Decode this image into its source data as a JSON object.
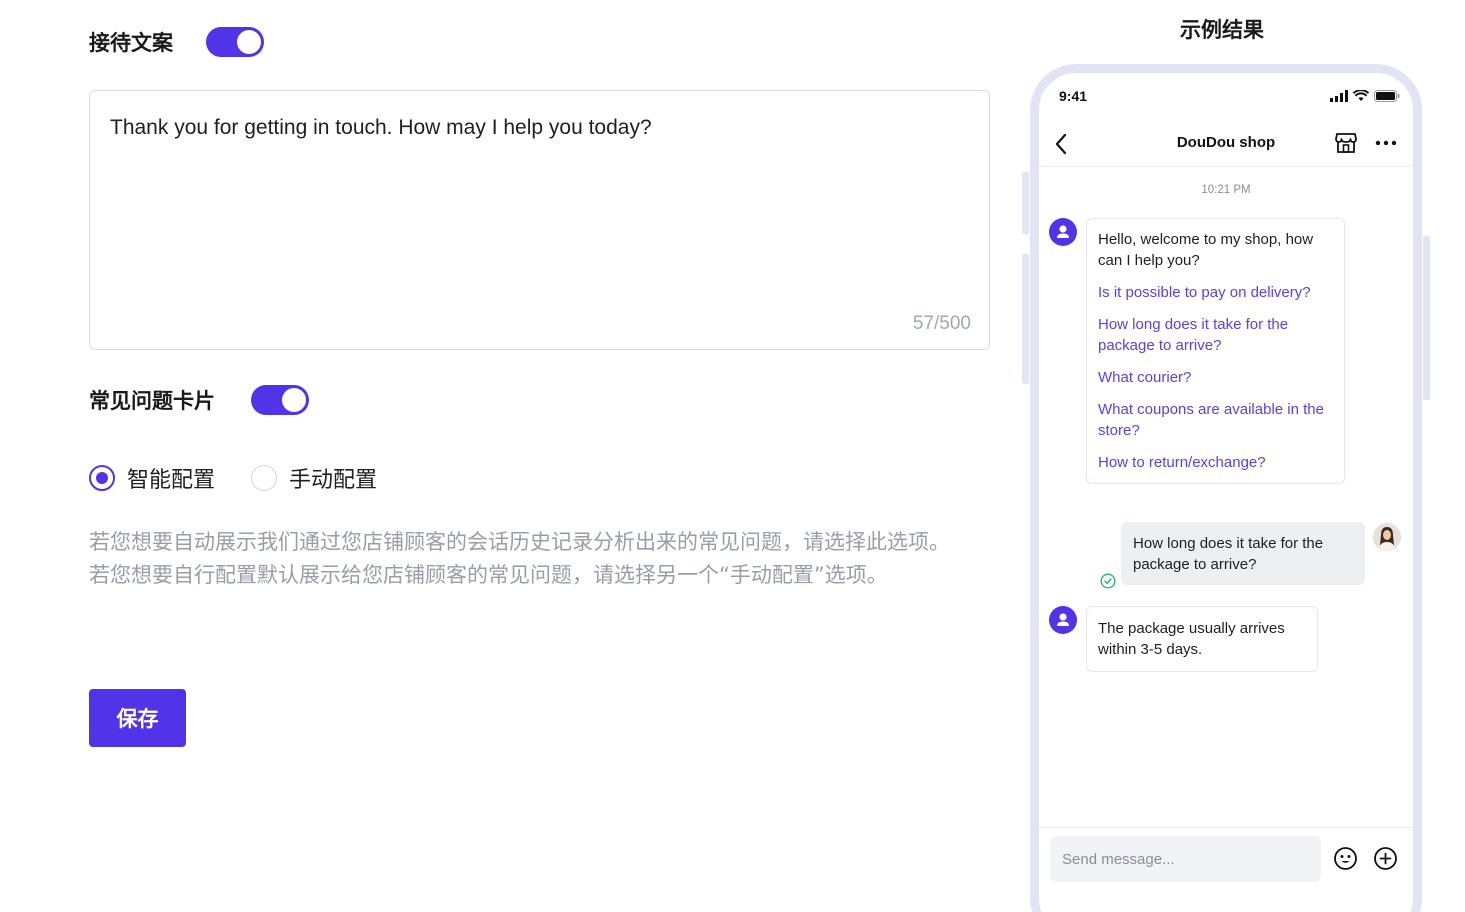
{
  "settings": {
    "greeting_title": "接待文案",
    "greeting_enabled": true,
    "greeting_text": "Thank you for getting in touch. How may I help you today?",
    "char_count": "57/500",
    "faq_title": "常见问题卡片",
    "faq_enabled": true,
    "radio_options": [
      {
        "label": "智能配置",
        "checked": true
      },
      {
        "label": "手动配置",
        "checked": false
      }
    ],
    "desc_line1": "若您想要自动展示我们通过您店铺顾客的会话历史记录分析出来的常见问题，请选择此选项。",
    "desc_line2": "若您想要自行配置默认展示给您店铺顾客的常见问题，请选择另一个“手动配置”选项。",
    "save_label": "保存"
  },
  "example": {
    "title": "示例结果",
    "status_time": "9:41",
    "shop_name": "DouDou shop",
    "chat_time": "10:21 PM",
    "welcome": "Hello, welcome to my shop, how can I help you?",
    "faq_questions": [
      "Is it possible to pay on delivery?",
      "How long does it take for the package to arrive?",
      "What courier?",
      "What coupons are available in the store?",
      "How to return/exchange?"
    ],
    "user_message": "How long does it take for the package to arrive?",
    "bot_reply": "The package usually arrives within 3-5 days.",
    "input_placeholder": "Send message..."
  },
  "colors": {
    "accent": "#5133e8",
    "link": "#5b40ea",
    "muted": "#9a9caa",
    "phone_frame": "#e2e4f6",
    "read_check": "#2db57a"
  },
  "icons": [
    "back-arrow-icon",
    "store-icon",
    "more-icon",
    "signal-icon",
    "wifi-icon",
    "battery-icon",
    "user-icon",
    "check-circle-icon",
    "emoji-icon",
    "plus-circle-icon"
  ]
}
